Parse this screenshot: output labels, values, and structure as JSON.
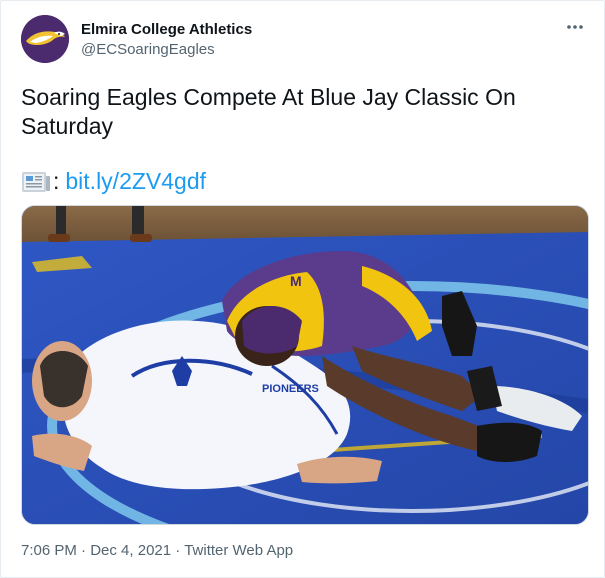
{
  "tweet": {
    "author_name": "Elmira College Athletics",
    "author_handle": "@ECSoaringEagles",
    "more_icon": "more-horizontal-icon",
    "text": "Soaring Eagles Compete At Blue Jay Classic On Saturday",
    "link_prefix": ":",
    "link_icon": "newspaper-icon",
    "link_text": "bit.ly/2ZV4gdf",
    "time": "7:06 PM",
    "sep1": "·",
    "date": "Dec 4, 2021",
    "sep2": "·",
    "source": "Twitter Web App"
  },
  "photo": {
    "singlet_text": "PIONEERS",
    "headgear_logo": "M"
  },
  "colors": {
    "link": "#1d9bf0",
    "secondary_text": "#536471",
    "eagle_purple": "#4b2a6e",
    "mat_blue": "#2b4fb8"
  }
}
